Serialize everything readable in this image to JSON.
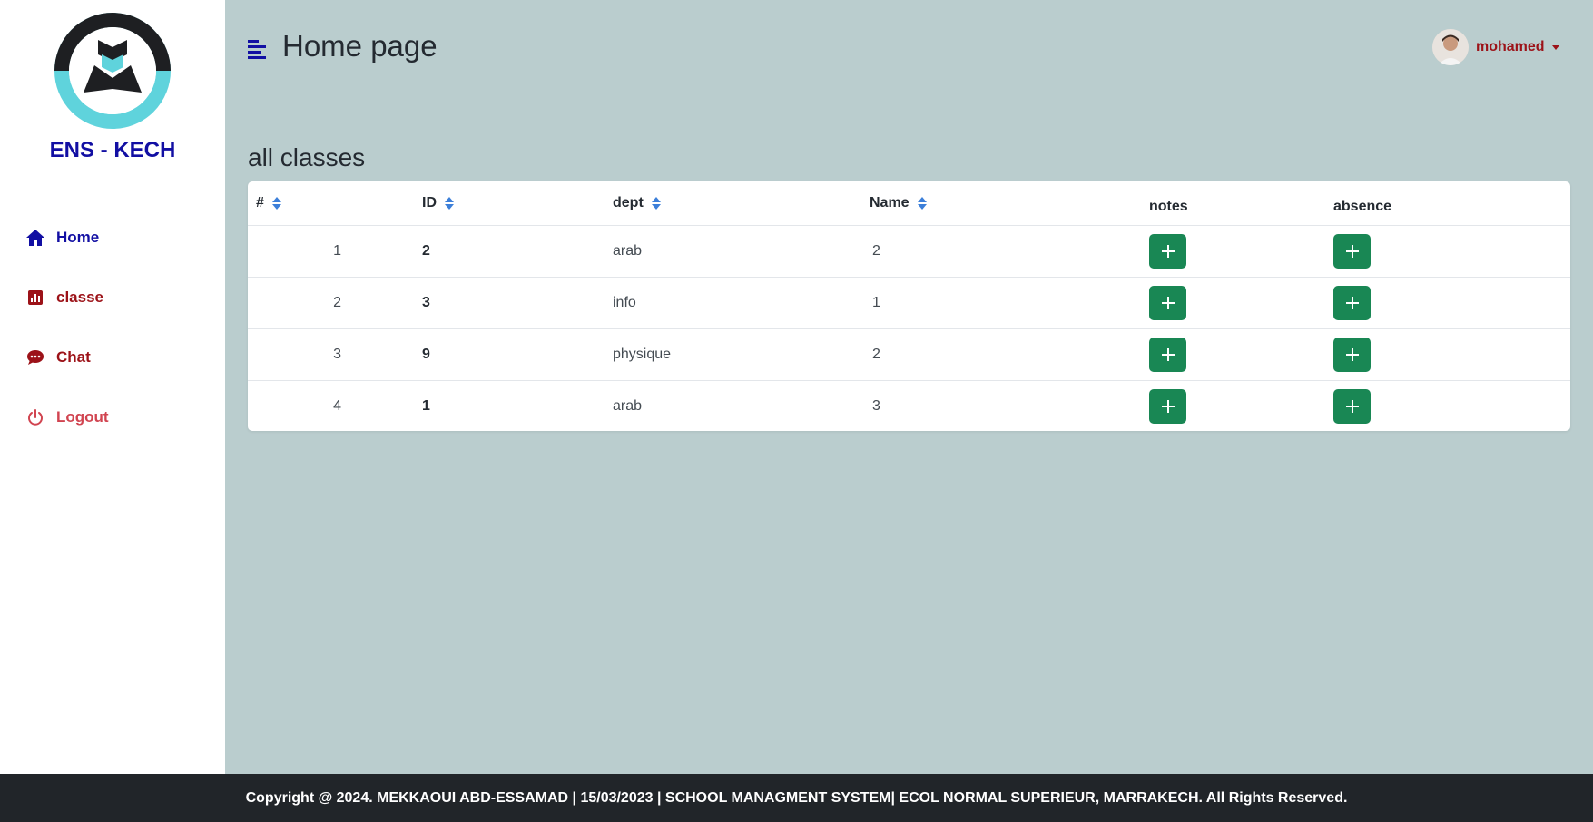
{
  "brand": {
    "name": "ENS - KECH"
  },
  "sidebar": {
    "items": [
      {
        "label": "Home",
        "icon": "home-icon",
        "color": "#120fa3"
      },
      {
        "label": "classe",
        "icon": "chart-icon",
        "color": "#9c1218"
      },
      {
        "label": "Chat",
        "icon": "chat-icon",
        "color": "#9c1218"
      },
      {
        "label": "Logout",
        "icon": "power-icon",
        "color": "#d14450"
      }
    ]
  },
  "header": {
    "title": "Home page",
    "menu_icon": "menu-icon",
    "user": {
      "name": "mohamed"
    }
  },
  "main": {
    "section_title": "all classes",
    "table": {
      "columns": [
        "#",
        "ID",
        "dept",
        "Name",
        "notes",
        "absence"
      ],
      "rows": [
        {
          "num": "1",
          "id": "2",
          "dept": "arab",
          "name": "2"
        },
        {
          "num": "2",
          "id": "3",
          "dept": "info",
          "name": "1"
        },
        {
          "num": "3",
          "id": "9",
          "dept": "physique",
          "name": "2"
        },
        {
          "num": "4",
          "id": "1",
          "dept": "arab",
          "name": "3"
        }
      ]
    }
  },
  "footer": {
    "text": "Copyright @ 2024. MEKKAOUI ABD-ESSAMAD | 15/03/2023 | SCHOOL MANAGMENT SYSTEM| ECOL NORMAL SUPERIEUR, MARRAKECH. All Rights Reserved."
  },
  "colors": {
    "background": "#bacdce",
    "primary_blue": "#120fa3",
    "dark_red": "#9c1218",
    "logout_red": "#d14450",
    "success_green": "#198754",
    "footer_bg": "#212529"
  }
}
